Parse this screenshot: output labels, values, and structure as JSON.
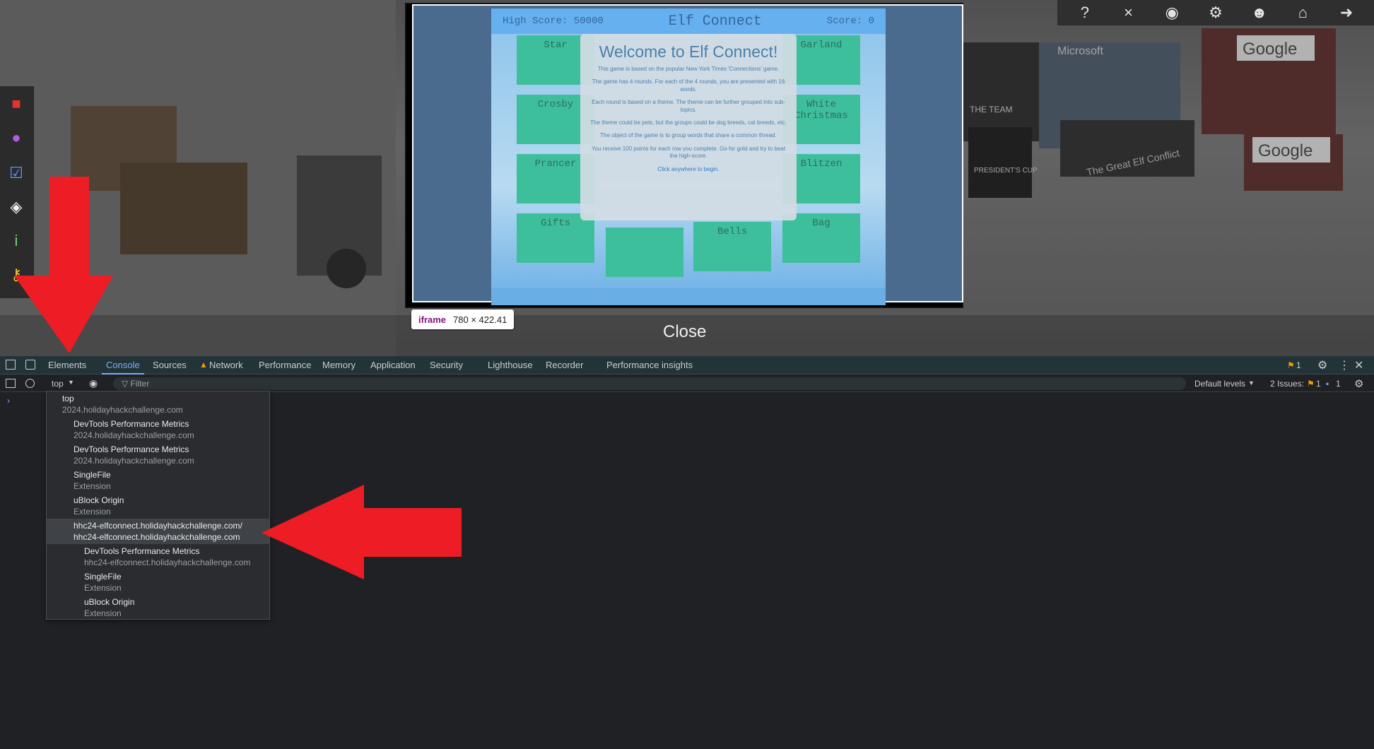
{
  "game": {
    "high_score_label": "High Score: 50000",
    "title": "Elf Connect",
    "score_label": "Score: 0",
    "tiles": [
      "Star",
      "Garland",
      "Crosby",
      "White Christmas",
      "Prancer",
      "Blitzen",
      "Gifts",
      "Bells",
      "Bag"
    ],
    "welcome": {
      "heading": "Welcome to Elf Connect!",
      "p1": "This game is based on the popular New York Times 'Connections' game.",
      "p2": "The game has 4 rounds. For each of the 4 rounds, you are presented with 16 words.",
      "p3": "Each round is based on a theme. The theme can be further grouped into sub-topics.",
      "p4": "The theme could be pets, but the groups could be dog breeds, cat breeds, etc.",
      "p5": "The object of the game is to group words that share a common thread.",
      "p6": "You receive 100 points for each row you complete. Go for gold and try to beat the high-score.",
      "click": "Click anywhere to begin."
    }
  },
  "iframe_tooltip": {
    "tag": "iframe",
    "dims": "780 × 422.41"
  },
  "close_label": "Close",
  "scene_signs": [
    "Microsoft",
    "Google",
    "Google",
    "The Great Elf Conflict",
    "PRESIDENT'S CUP",
    "THE TEAM"
  ],
  "devtools": {
    "tabs": [
      "Elements",
      "Console",
      "Sources",
      "Network",
      "Performance",
      "Memory",
      "Application",
      "Security",
      "Lighthouse",
      "Recorder",
      "Performance insights"
    ],
    "issues_badge": "1",
    "context_selected": "top",
    "filter_placeholder": "Filter",
    "default_levels": "Default levels",
    "issues_label": "2 Issues:",
    "issues_warn": "1",
    "issues_info": "1",
    "contexts": [
      {
        "name": "top",
        "sub": "2024.holidayhackchallenge.com",
        "level": 0
      },
      {
        "name": "DevTools Performance Metrics",
        "sub": "2024.holidayhackchallenge.com",
        "level": 1
      },
      {
        "name": "DevTools Performance Metrics",
        "sub": "2024.holidayhackchallenge.com",
        "level": 1
      },
      {
        "name": "SingleFile",
        "sub": "Extension",
        "level": 1
      },
      {
        "name": "uBlock Origin",
        "sub": "Extension",
        "level": 1
      },
      {
        "name": "hhc24-elfconnect.holidayhackchallenge.com/",
        "sub": "hhc24-elfconnect.holidayhackchallenge.com",
        "level": 1,
        "selected": true
      },
      {
        "name": "DevTools Performance Metrics",
        "sub": "hhc24-elfconnect.holidayhackchallenge.com",
        "level": 2
      },
      {
        "name": "SingleFile",
        "sub": "Extension",
        "level": 2
      },
      {
        "name": "uBlock Origin",
        "sub": "Extension",
        "level": 2
      }
    ]
  },
  "colors": {
    "arrow": "#ee1c24",
    "accent": "#7cacf8",
    "tile": "#3ebf9b"
  }
}
